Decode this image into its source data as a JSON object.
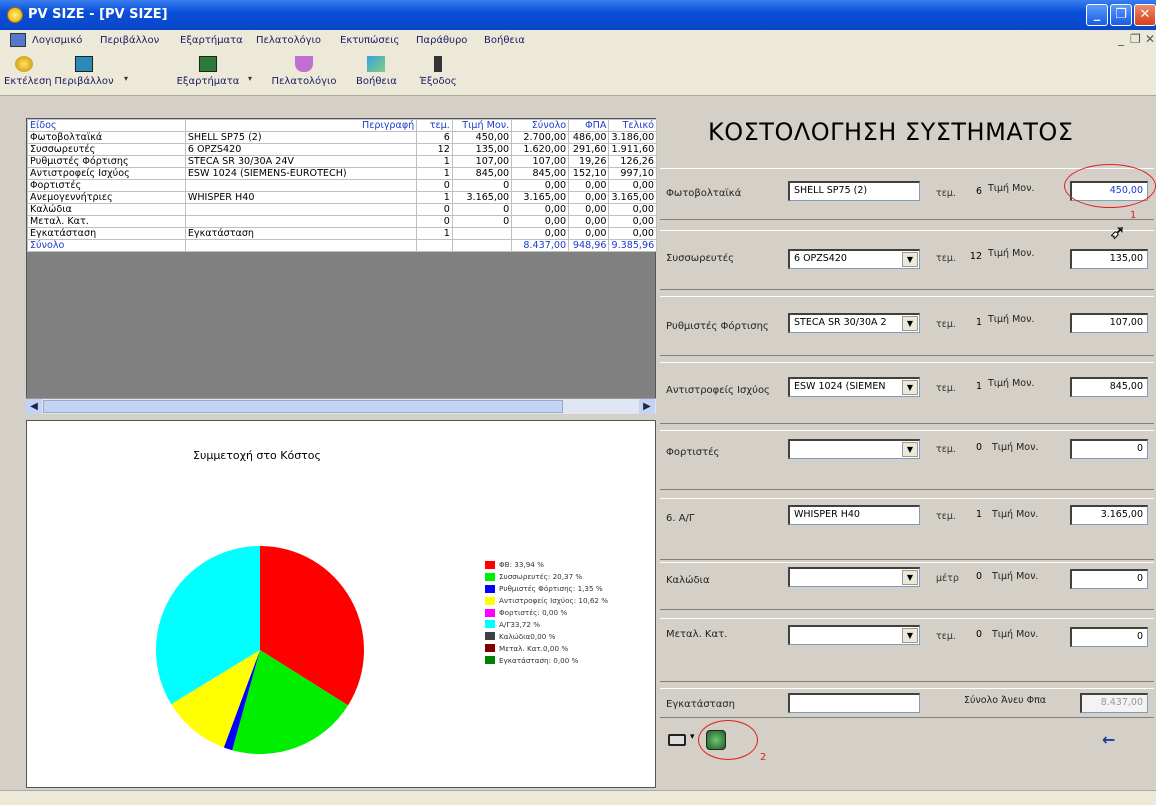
{
  "window": {
    "title": "PV SIZE - [PV SIZE]"
  },
  "menu": [
    "Λογισμικό",
    "Περιβάλλον",
    "Εξαρτήματα",
    "Πελατολόγιο",
    "Εκτυπώσεις",
    "Παράθυρο",
    "Βοήθεια"
  ],
  "toolbar": {
    "run": "Εκτέλεση",
    "env": "Περιβάλλον",
    "parts": "Εξαρτήματα",
    "clients": "Πελατολόγιο",
    "help": "Βοήθεια",
    "exit": "Έξοδος"
  },
  "grid": {
    "headers": [
      "Είδος",
      "Περιγραφή",
      "τεμ.",
      "Τιμή Μον.",
      "Σύνολο",
      "ΦΠΑ",
      "Τελικό"
    ],
    "rows": [
      [
        "Φωτοβολταϊκά",
        "SHELL SP75 (2)",
        "6",
        "450,00",
        "2.700,00",
        "486,00",
        "3.186,00"
      ],
      [
        "Συσσωρευτές",
        "6 OPZS420",
        "12",
        "135,00",
        "1.620,00",
        "291,60",
        "1.911,60"
      ],
      [
        "Ρυθμιστές Φόρτισης",
        "STECA SR 30/30A 24V",
        "1",
        "107,00",
        "107,00",
        "19,26",
        "126,26"
      ],
      [
        "Αντιστροφείς Ισχύος",
        "ESW 1024 (SIEMENS-EUROTECH)",
        "1",
        "845,00",
        "845,00",
        "152,10",
        "997,10"
      ],
      [
        "Φορτιστές",
        "",
        "0",
        "0",
        "0,00",
        "0,00",
        "0,00"
      ],
      [
        "Ανεμογεννήτριες",
        "WHISPER H40",
        "1",
        "3.165,00",
        "3.165,00",
        "0,00",
        "3.165,00"
      ],
      [
        "Καλώδια",
        "",
        "0",
        "0",
        "0,00",
        "0,00",
        "0,00"
      ],
      [
        "Μεταλ. Κατ.",
        "",
        "0",
        "0",
        "0,00",
        "0,00",
        "0,00"
      ],
      [
        "Εγκατάσταση",
        "Εγκατάσταση",
        "1",
        "",
        "0,00",
        "0,00",
        "0,00"
      ]
    ],
    "total": [
      "Σύνολο",
      "",
      "",
      "",
      "8.437,00",
      "948,96",
      "9.385,96"
    ]
  },
  "chart": {
    "title": "Συμμετοχή στο Κόστος"
  },
  "chart_data": {
    "type": "pie",
    "title": "Συμμετοχή στο Κόστος",
    "slices": [
      {
        "label": "ΦΒ: 33,94 %",
        "value": 33.94,
        "color": "#ff0000"
      },
      {
        "label": "Συσσωρευτές: 20,37 %",
        "value": 20.37,
        "color": "#00ee00"
      },
      {
        "label": "Ρυθμιστές Φόρτισης: 1,35 %",
        "value": 1.35,
        "color": "#0000ff"
      },
      {
        "label": "Αντιστροφείς Ισχύος: 10,62 %",
        "value": 10.62,
        "color": "#ffff00"
      },
      {
        "label": "Φορτιστές: 0,00 %",
        "value": 0,
        "color": "#ff00ff"
      },
      {
        "label": "Α/Γ33,72 %",
        "value": 33.72,
        "color": "#00ffff"
      },
      {
        "label": "Καλώδια0,00 %",
        "value": 0,
        "color": "#404040"
      },
      {
        "label": "Μεταλ. Κατ.0,00 %",
        "value": 0,
        "color": "#800000"
      },
      {
        "label": "Εγκατάσταση: 0,00 %",
        "value": 0,
        "color": "#008000"
      }
    ]
  },
  "costing": {
    "title": "ΚΟΣΤΟΛΟΓΗΣΗ ΣΥΣΤΗΜΑΤΟΣ",
    "pv": {
      "label": "Φωτοβολταϊκά",
      "model": "SHELL SP75 (2)",
      "unit": "τεμ.",
      "qty": "6",
      "price_label": "Τιμή Μον.",
      "price": "450,00"
    },
    "batteries": {
      "label": "Συσσωρευτές",
      "model": "6 OPZS420",
      "unit": "τεμ.",
      "qty": "12",
      "price_label": "Τιμή Μον.",
      "price": "135,00"
    },
    "regulators": {
      "label": "Ρυθμιστές Φόρτισης",
      "model": "STECA SR 30/30A 2",
      "unit": "τεμ.",
      "qty": "1",
      "price_label": "Τιμή Μον.",
      "price": "107,00"
    },
    "inverters": {
      "label": "Αντιστροφείς Ισχύος",
      "model": "ESW 1024 (SIEMEN",
      "unit": "τεμ.",
      "qty": "1",
      "price_label": "Τιμή Μον.",
      "price": "845,00"
    },
    "chargers": {
      "label": "Φορτιστές",
      "model": "",
      "unit": "τεμ.",
      "qty": "0",
      "price_label": "Τιμή Μον.",
      "price": "0"
    },
    "wind": {
      "label": "6. Α/Γ",
      "model": "WHISPER H40",
      "unit": "τεμ.",
      "qty": "1",
      "price_label": "Τιμή Μον.",
      "price": "3.165,00"
    },
    "cables": {
      "label": "Καλώδια",
      "model": "",
      "unit": "μέτρ",
      "qty": "0",
      "price_label": "Τιμή Μον.",
      "price": "0"
    },
    "metal": {
      "label": "Μεταλ. Κατ.",
      "model": "",
      "unit": "τεμ.",
      "qty": "0",
      "price_label": "Τιμή Μον.",
      "price": "0"
    },
    "install": {
      "label": "Εγκατάσταση",
      "value": "",
      "total_label": "Σύνολο Άνευ Φπα",
      "total": "8.437,00"
    }
  },
  "annotations": {
    "n1": "1",
    "n2": "2"
  }
}
